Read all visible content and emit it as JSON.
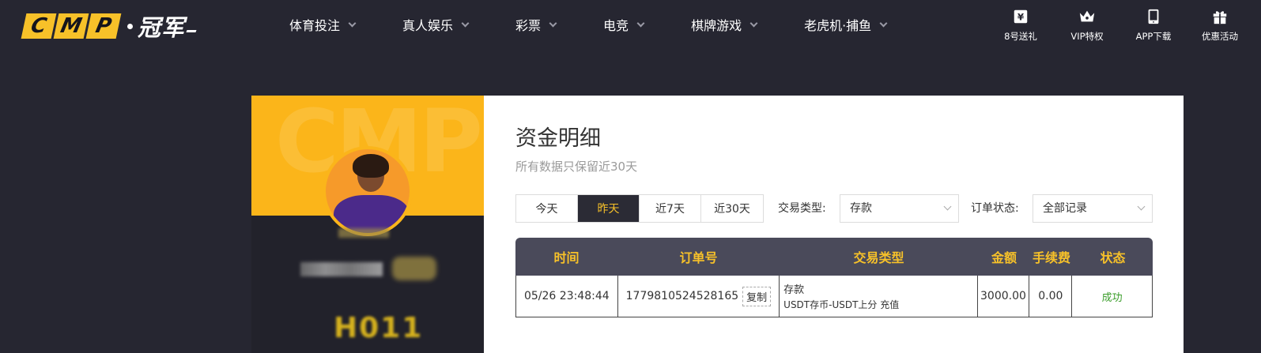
{
  "brand": {
    "letters": [
      "C",
      "M",
      "P"
    ],
    "cn_name": "冠军"
  },
  "nav": [
    {
      "label": "体育投注"
    },
    {
      "label": "真人娱乐"
    },
    {
      "label": "彩票"
    },
    {
      "label": "电竞"
    },
    {
      "label": "棋牌游戏"
    },
    {
      "label": "老虎机·捕鱼"
    }
  ],
  "utilities": [
    {
      "label": "8号送礼",
      "icon": "ticket-yen-icon"
    },
    {
      "label": "VIP特权",
      "icon": "crown-icon"
    },
    {
      "label": "APP下载",
      "icon": "tablet-icon"
    },
    {
      "label": "优惠活动",
      "icon": "gift-icon"
    }
  ],
  "profile": {
    "watermark": "CMP",
    "vip_level": "H011"
  },
  "page": {
    "title": "资金明细",
    "subtitle": "所有数据只保留近30天"
  },
  "date_ranges": [
    {
      "label": "今天",
      "active": false
    },
    {
      "label": "昨天",
      "active": true
    },
    {
      "label": "近7天",
      "active": false
    },
    {
      "label": "近30天",
      "active": false
    }
  ],
  "filters": {
    "tx_type_label": "交易类型:",
    "tx_type_value": "存款",
    "status_label": "订单状态:",
    "status_value": "全部记录"
  },
  "table": {
    "headers": [
      "时间",
      "订单号",
      "交易类型",
      "金额",
      "手续费",
      "状态"
    ],
    "rows": [
      {
        "time": "05/26 23:48:44",
        "order_no": "1779810524528165",
        "copy_label": "复制",
        "type_main": "存款",
        "type_detail": "USDT存币-USDT上分 充值",
        "amount": "3000.00",
        "fee": "0.00",
        "status": "成功"
      }
    ]
  },
  "colors": {
    "accent": "#f7c129",
    "background": "#262631",
    "success": "#3a9d2a"
  }
}
